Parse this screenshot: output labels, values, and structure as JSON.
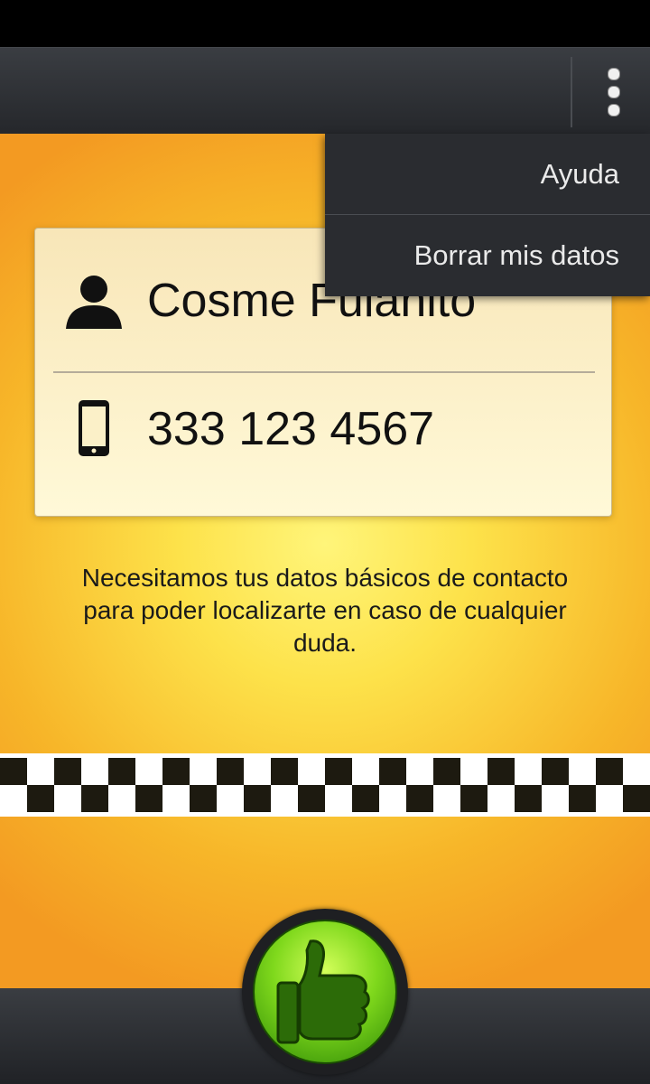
{
  "contact": {
    "name": "Cosme Fulanito",
    "phone": "333 123 4567"
  },
  "info": {
    "message": "Necesitamos tus datos básicos de contacto para poder localizarte en caso de cualquier duda."
  },
  "menu": {
    "items": [
      {
        "label": "Ayuda"
      },
      {
        "label": "Borrar mis datos"
      }
    ]
  },
  "icons": {
    "overflow": "more-vert-icon",
    "person": "person-icon",
    "phone": "smartphone-icon",
    "confirm": "thumbs-up-icon"
  },
  "colors": {
    "accent_yellow": "#fde24a",
    "accent_orange": "#f39a22",
    "confirm_green": "#7fd81c",
    "bar_dark": "#2a2c30"
  }
}
